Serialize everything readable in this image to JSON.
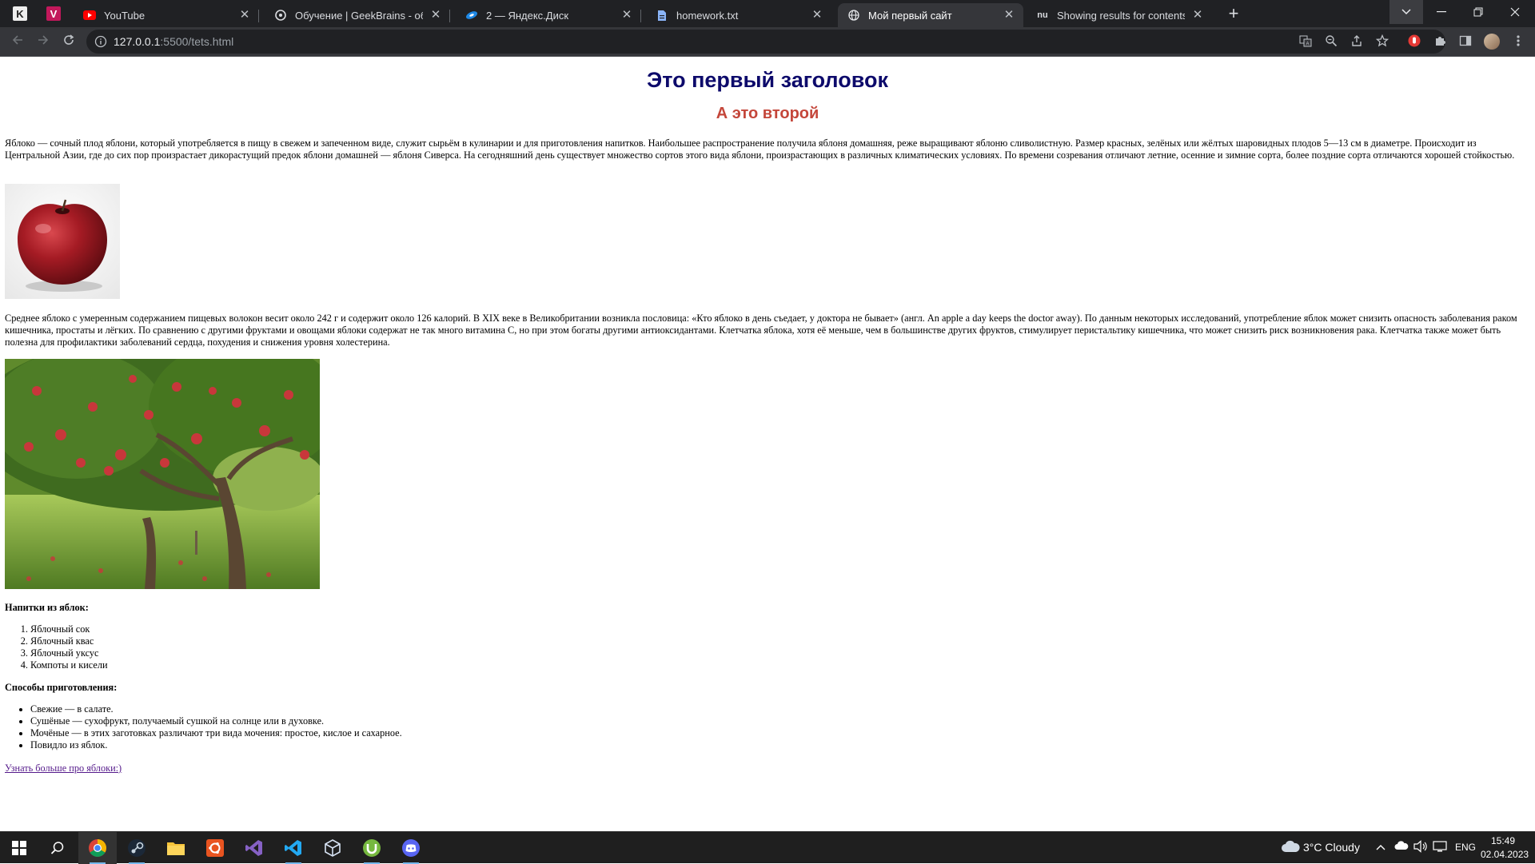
{
  "browser": {
    "pinned_tabs": [
      {
        "icon": "k-icon",
        "letter": "K"
      },
      {
        "icon": "v-icon",
        "letter": "V"
      }
    ],
    "tabs": [
      {
        "title": "YouTube",
        "icon": "youtube-icon",
        "active": false
      },
      {
        "title": "Обучение | GeekBrains - образо",
        "icon": "geekbrains-icon",
        "active": false
      },
      {
        "title": "2 — Яндекс.Диск",
        "icon": "yandex-disk-icon",
        "active": false
      },
      {
        "title": "homework.txt",
        "icon": "document-icon",
        "active": false
      },
      {
        "title": "Мой первый сайт",
        "icon": "globe-icon",
        "active": true
      },
      {
        "title": "Showing results for contents of t",
        "icon": "nu-icon",
        "active": false
      }
    ],
    "address": {
      "host": "127.0.0.1",
      "path": ":5500/tets.html"
    }
  },
  "page": {
    "heading1": "Это первый заголовок",
    "heading2": "А это второй",
    "paragraph1": "Яблоко — сочный плод яблони, который употребляется в пищу в свежем и запеченном виде, служит сырьём в кулинарии и для приготовления напитков. Наибольшее распространение получила яблоня домашняя, реже выращивают яблоню сливолистную. Размер красных, зелёных или жёлтых шаровидных плодов 5—13 см в диаметре. Происходит из Центральной Азии, где до сих пор произрастает дикорастущий предок яблони домашней — яблоня Сиверса. На сегодняшний день существует множество сортов этого вида яблони, произрастающих в различных климатических условиях. По времени созревания отличают летние, осенние и зимние сорта, более поздние сорта отличаются хорошей стойкостью.",
    "paragraph2": "Среднее яблоко с умеренным содержанием пищевых волокон весит около 242 г и содержит около 126 калорий. В XIX веке в Великобритании возникла пословица: «Кто яблоко в день съедает, у доктора не бывает» (англ. An apple a day keeps the doctor away). По данным некоторых исследований, употребление яблок может снизить опасность заболевания раком кишечника, простаты и лёгких. По сравнению с другими фруктами и овощами яблоки содержат не так много витамина C, но при этом богаты другими антиоксидантами. Клетчатка яблока, хотя её меньше, чем в большинстве других фруктов, стимулирует перистальтику кишечника, что может снизить риск возникновения рака. Клетчатка также может быть полезна для профилактики заболеваний сердца, похудения и снижения уровня холестерина.",
    "drinks_title": "Напитки из яблок:",
    "drinks": [
      "Яблочный сок",
      "Яблочный квас",
      "Яблочный уксус",
      "Компоты и кисели"
    ],
    "methods_title": "Способы приготовления:",
    "methods": [
      "Свежие — в салате.",
      "Сушёные — сухофрукт, получаемый сушкой на солнце или в духовке.",
      "Мочёные — в этих заготовках различают три вида мочения: простое, кислое и сахарное.",
      "Повидло из яблок."
    ],
    "link_text": "Узнать больше про яблоки:)"
  },
  "taskbar": {
    "apps": [
      "windows-start-icon",
      "search-icon",
      "chrome-icon",
      "steam-icon",
      "file-explorer-icon",
      "ubuntu-icon",
      "visual-studio-icon",
      "vscode-icon",
      "box-icon",
      "utorrent-icon",
      "discord-icon"
    ],
    "weather": "3°C  Cloudy",
    "language": "ENG",
    "time": "15:49",
    "date": "02.04.2023"
  },
  "colors": {
    "heading1": "#0d0a6b",
    "heading2": "#c4463a",
    "link": "#551a8b",
    "tabstrip_bg": "#202124",
    "toolbar_bg": "#35363a"
  }
}
